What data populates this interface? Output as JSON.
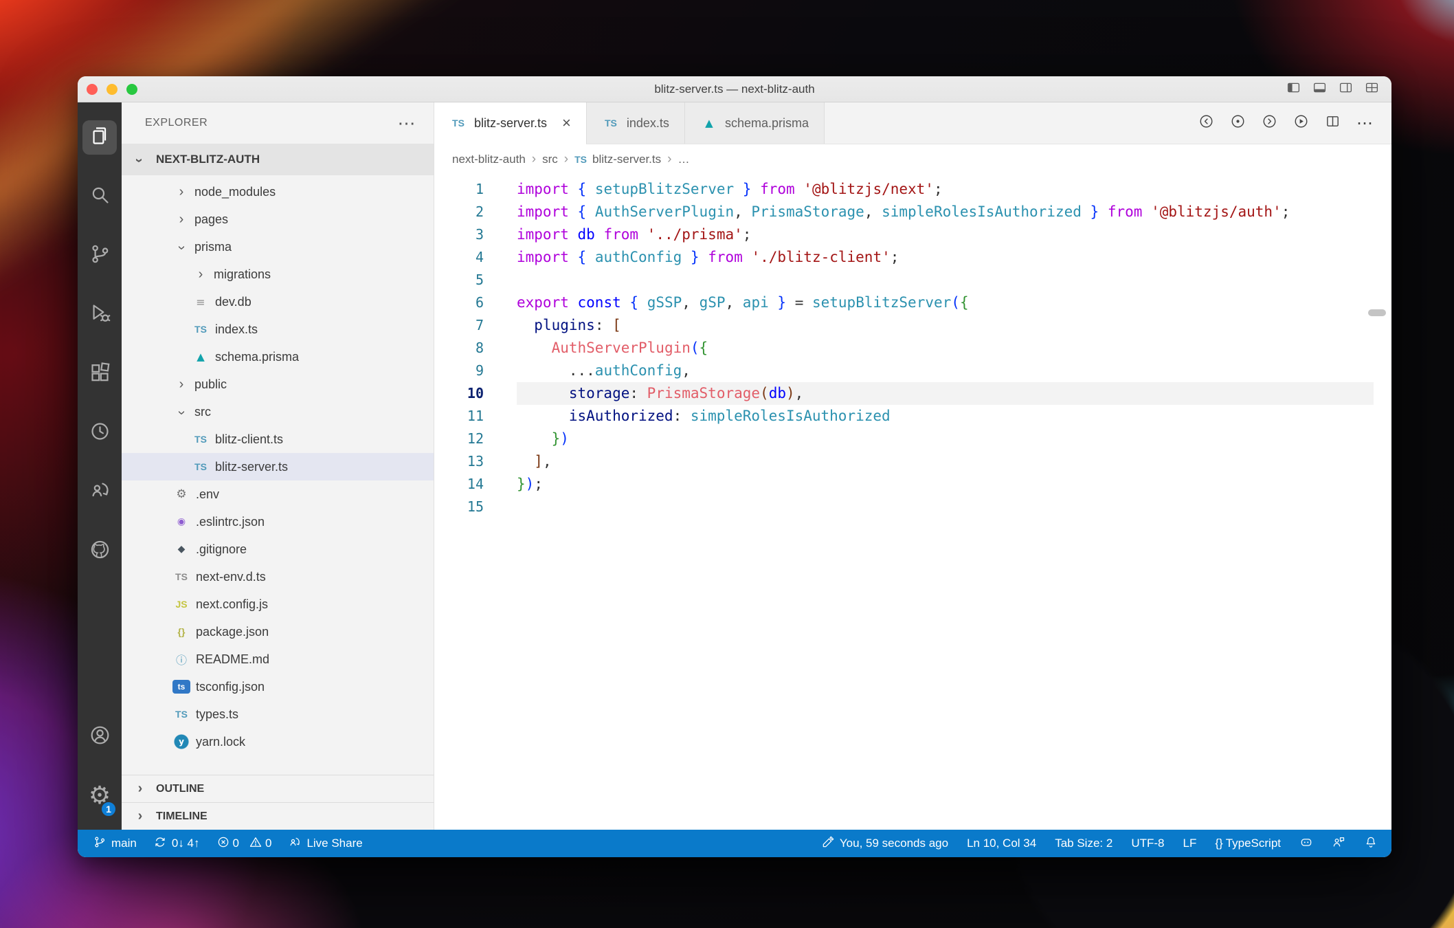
{
  "window": {
    "title": "blitz-server.ts — next-blitz-auth"
  },
  "activity_bar": {
    "settings_badge": "1"
  },
  "explorer": {
    "title": "EXPLORER",
    "section": "NEXT-BLITZ-AUTH",
    "outline": "OUTLINE",
    "timeline": "TIMELINE"
  },
  "files": {
    "tree": [
      {
        "label": "node_modules",
        "type": "folder",
        "collapsed": true,
        "indent": 1
      },
      {
        "label": "pages",
        "type": "folder",
        "collapsed": true,
        "indent": 1
      },
      {
        "label": "prisma",
        "type": "folder",
        "collapsed": false,
        "indent": 1
      },
      {
        "label": "migrations",
        "type": "folder",
        "collapsed": true,
        "indent": 2
      },
      {
        "label": "dev.db",
        "type": "file",
        "icon": "file",
        "indent": 2
      },
      {
        "label": "index.ts",
        "type": "file",
        "icon": "ts",
        "indent": 2
      },
      {
        "label": "schema.prisma",
        "type": "file",
        "icon": "prisma",
        "indent": 2
      },
      {
        "label": "public",
        "type": "folder",
        "collapsed": true,
        "indent": 1
      },
      {
        "label": "src",
        "type": "folder",
        "collapsed": false,
        "indent": 1
      },
      {
        "label": "blitz-client.ts",
        "type": "file",
        "icon": "ts",
        "indent": 2
      },
      {
        "label": "blitz-server.ts",
        "type": "file",
        "icon": "ts",
        "indent": 2,
        "selected": true
      },
      {
        "label": ".env",
        "type": "file",
        "icon": "gear",
        "indent": 1
      },
      {
        "label": ".eslintrc.json",
        "type": "file",
        "icon": "eslint",
        "indent": 1
      },
      {
        "label": ".gitignore",
        "type": "file",
        "icon": "git",
        "indent": 1
      },
      {
        "label": "next-env.d.ts",
        "type": "file",
        "icon": "ts-gray",
        "indent": 1
      },
      {
        "label": "next.config.js",
        "type": "file",
        "icon": "js",
        "indent": 1
      },
      {
        "label": "package.json",
        "type": "file",
        "icon": "braces",
        "indent": 1
      },
      {
        "label": "README.md",
        "type": "file",
        "icon": "info",
        "indent": 1
      },
      {
        "label": "tsconfig.json",
        "type": "file",
        "icon": "tsconfig",
        "indent": 1
      },
      {
        "label": "types.ts",
        "type": "file",
        "icon": "ts",
        "indent": 1
      },
      {
        "label": "yarn.lock",
        "type": "file",
        "icon": "yarn",
        "indent": 1
      }
    ]
  },
  "icon_glyphs": {
    "ts": "TS",
    "ts-gray": "TS",
    "js": "JS",
    "prisma": "▲",
    "gear": "⚙",
    "eslint": "◉",
    "git": "◆",
    "braces": "{}",
    "info": "ⓘ",
    "tsconfig": "ts",
    "yarn": "y",
    "file": "≡"
  },
  "tabs": [
    {
      "label": "blitz-server.ts",
      "icon": "ts",
      "active": true,
      "close": "×"
    },
    {
      "label": "index.ts",
      "icon": "ts",
      "active": false
    },
    {
      "label": "schema.prisma",
      "icon": "prisma",
      "active": false
    }
  ],
  "breadcrumb": [
    {
      "label": "next-blitz-auth"
    },
    {
      "label": "src"
    },
    {
      "label": "blitz-server.ts",
      "icon": "ts"
    },
    {
      "label": "…"
    }
  ],
  "editor": {
    "current_line": 10,
    "lines": [
      {
        "num": 1,
        "tokens": [
          [
            "kw",
            "import "
          ],
          [
            "br1",
            "{"
          ],
          [
            "pn",
            " "
          ],
          [
            "teal",
            "setupBlitzServer"
          ],
          [
            "pn",
            " "
          ],
          [
            "br1",
            "}"
          ],
          [
            "kw",
            " from "
          ],
          [
            "str",
            "'@blitzjs/next'"
          ],
          [
            "pn",
            ";"
          ]
        ]
      },
      {
        "num": 2,
        "tokens": [
          [
            "kw",
            "import "
          ],
          [
            "br1",
            "{"
          ],
          [
            "pn",
            " "
          ],
          [
            "teal",
            "AuthServerPlugin"
          ],
          [
            "pn",
            ", "
          ],
          [
            "teal",
            "PrismaStorage"
          ],
          [
            "pn",
            ", "
          ],
          [
            "teal",
            "simpleRolesIsAuthorized"
          ],
          [
            "pn",
            " "
          ],
          [
            "br1",
            "}"
          ],
          [
            "kw",
            " from "
          ],
          [
            "str",
            "'@blitzjs/auth'"
          ],
          [
            "pn",
            ";"
          ]
        ]
      },
      {
        "num": 3,
        "tokens": [
          [
            "kw",
            "import "
          ],
          [
            "blue",
            "db"
          ],
          [
            "kw",
            " from "
          ],
          [
            "str",
            "'../prisma'"
          ],
          [
            "pn",
            ";"
          ]
        ]
      },
      {
        "num": 4,
        "tokens": [
          [
            "kw",
            "import "
          ],
          [
            "br1",
            "{"
          ],
          [
            "pn",
            " "
          ],
          [
            "teal",
            "authConfig"
          ],
          [
            "pn",
            " "
          ],
          [
            "br1",
            "}"
          ],
          [
            "kw",
            " from "
          ],
          [
            "str",
            "'./blitz-client'"
          ],
          [
            "pn",
            ";"
          ]
        ]
      },
      {
        "num": 5,
        "tokens": []
      },
      {
        "num": 6,
        "tokens": [
          [
            "kw",
            "export "
          ],
          [
            "blue",
            "const "
          ],
          [
            "br1",
            "{"
          ],
          [
            "pn",
            " "
          ],
          [
            "teal",
            "gSSP"
          ],
          [
            "pn",
            ", "
          ],
          [
            "teal",
            "gSP"
          ],
          [
            "pn",
            ", "
          ],
          [
            "teal",
            "api"
          ],
          [
            "pn",
            " "
          ],
          [
            "br1",
            "}"
          ],
          [
            "pn",
            " = "
          ],
          [
            "teal",
            "setupBlitzServer"
          ],
          [
            "br1",
            "("
          ],
          [
            "br2",
            "{"
          ]
        ]
      },
      {
        "num": 7,
        "tokens": [
          [
            "pn",
            "  "
          ],
          [
            "prop",
            "plugins"
          ],
          [
            "pn",
            ": "
          ],
          [
            "br3",
            "["
          ]
        ]
      },
      {
        "num": 8,
        "tokens": [
          [
            "pn",
            "    "
          ],
          [
            "fn",
            "AuthServerPlugin"
          ],
          [
            "br1",
            "("
          ],
          [
            "br2",
            "{"
          ]
        ]
      },
      {
        "num": 9,
        "tokens": [
          [
            "pn",
            "      ..."
          ],
          [
            "teal",
            "authConfig"
          ],
          [
            "pn",
            ","
          ]
        ]
      },
      {
        "num": 10,
        "tokens": [
          [
            "pn",
            "      "
          ],
          [
            "prop",
            "storage"
          ],
          [
            "pn",
            ": "
          ],
          [
            "fn",
            "PrismaStorage"
          ],
          [
            "br3",
            "("
          ],
          [
            "blue",
            "db"
          ],
          [
            "br3",
            ")"
          ],
          [
            "pn",
            ","
          ]
        ]
      },
      {
        "num": 11,
        "tokens": [
          [
            "pn",
            "      "
          ],
          [
            "prop",
            "isAuthorized"
          ],
          [
            "pn",
            ": "
          ],
          [
            "teal",
            "simpleRolesIsAuthorized"
          ]
        ]
      },
      {
        "num": 12,
        "tokens": [
          [
            "pn",
            "    "
          ],
          [
            "br2",
            "}"
          ],
          [
            "br1",
            ")"
          ]
        ]
      },
      {
        "num": 13,
        "tokens": [
          [
            "pn",
            "  "
          ],
          [
            "br3",
            "]"
          ],
          [
            "pn",
            ","
          ]
        ]
      },
      {
        "num": 14,
        "tokens": [
          [
            "br2",
            "}"
          ],
          [
            "br1",
            ")"
          ],
          [
            "pn",
            ";"
          ]
        ]
      },
      {
        "num": 15,
        "tokens": []
      }
    ]
  },
  "status_bar": {
    "branch": "main",
    "sync": "0↓ 4↑",
    "errors": "0",
    "warnings": "0",
    "live_share": "Live Share",
    "annotation": "You, 59 seconds ago",
    "cursor": "Ln 10, Col 34",
    "tab_size": "Tab Size: 2",
    "encoding": "UTF-8",
    "eol": "LF",
    "braces_icon": "{}",
    "language": "TypeScript"
  },
  "colors": {
    "keyword": "#AF00DB",
    "keyword2": "#0000FF",
    "identifier": "#2B91AF",
    "function": "#E25D68",
    "string": "#A31515",
    "property": "#001080",
    "punctuation": "#333333",
    "bracket1": "#0431FA",
    "bracket2": "#319331",
    "bracket3": "#7B3814",
    "status_bar_bg": "#0A7ACA",
    "badge": "#0F7FD7",
    "selection_bg": "#E4E6F1"
  }
}
